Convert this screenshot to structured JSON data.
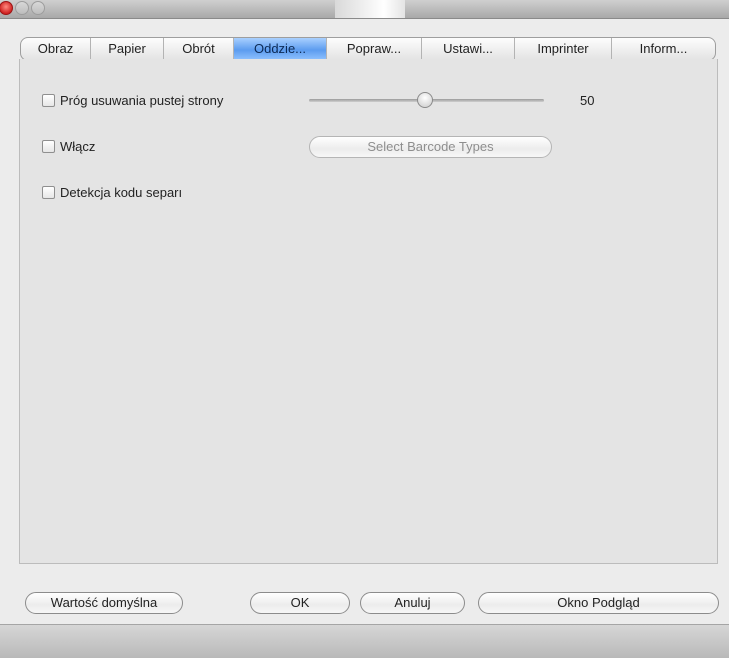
{
  "tabs": [
    {
      "label": "Obraz"
    },
    {
      "label": "Papier"
    },
    {
      "label": "Obrót"
    },
    {
      "label": "Oddzie..."
    },
    {
      "label": "Popraw..."
    },
    {
      "label": "Ustawi..."
    },
    {
      "label": "Imprinter"
    },
    {
      "label": "Inform..."
    }
  ],
  "selected_tab": "Oddzie...",
  "options": {
    "blank_page": {
      "label": "Próg usuwania pustej strony",
      "checked": false,
      "slider_value": "50"
    },
    "enable": {
      "label": "Włącz",
      "checked": false
    },
    "separator": {
      "label": "Detekcja kodu separı",
      "checked": false
    }
  },
  "barcode_button": "Select Barcode Types",
  "buttons": {
    "default": "Wartość domyślna",
    "ok": "OK",
    "cancel": "Anuluj",
    "preview": "Okno Podgląd"
  }
}
